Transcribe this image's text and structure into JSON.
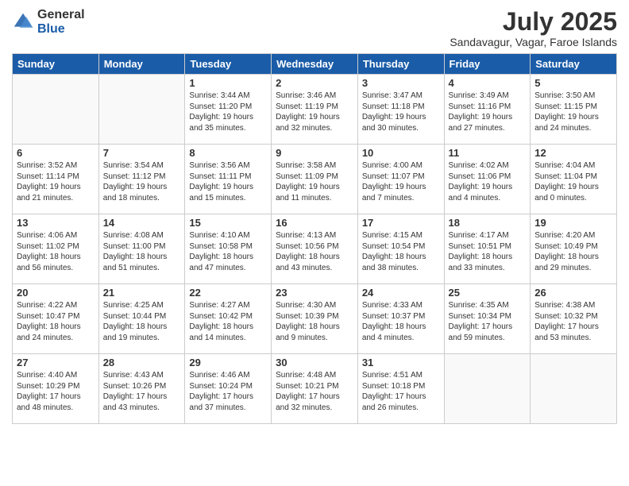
{
  "logo": {
    "general": "General",
    "blue": "Blue"
  },
  "header": {
    "month": "July 2025",
    "location": "Sandavagur, Vagar, Faroe Islands"
  },
  "weekdays": [
    "Sunday",
    "Monday",
    "Tuesday",
    "Wednesday",
    "Thursday",
    "Friday",
    "Saturday"
  ],
  "weeks": [
    [
      {
        "day": "",
        "info": ""
      },
      {
        "day": "",
        "info": ""
      },
      {
        "day": "1",
        "info": "Sunrise: 3:44 AM\nSunset: 11:20 PM\nDaylight: 19 hours and 35 minutes."
      },
      {
        "day": "2",
        "info": "Sunrise: 3:46 AM\nSunset: 11:19 PM\nDaylight: 19 hours and 32 minutes."
      },
      {
        "day": "3",
        "info": "Sunrise: 3:47 AM\nSunset: 11:18 PM\nDaylight: 19 hours and 30 minutes."
      },
      {
        "day": "4",
        "info": "Sunrise: 3:49 AM\nSunset: 11:16 PM\nDaylight: 19 hours and 27 minutes."
      },
      {
        "day": "5",
        "info": "Sunrise: 3:50 AM\nSunset: 11:15 PM\nDaylight: 19 hours and 24 minutes."
      }
    ],
    [
      {
        "day": "6",
        "info": "Sunrise: 3:52 AM\nSunset: 11:14 PM\nDaylight: 19 hours and 21 minutes."
      },
      {
        "day": "7",
        "info": "Sunrise: 3:54 AM\nSunset: 11:12 PM\nDaylight: 19 hours and 18 minutes."
      },
      {
        "day": "8",
        "info": "Sunrise: 3:56 AM\nSunset: 11:11 PM\nDaylight: 19 hours and 15 minutes."
      },
      {
        "day": "9",
        "info": "Sunrise: 3:58 AM\nSunset: 11:09 PM\nDaylight: 19 hours and 11 minutes."
      },
      {
        "day": "10",
        "info": "Sunrise: 4:00 AM\nSunset: 11:07 PM\nDaylight: 19 hours and 7 minutes."
      },
      {
        "day": "11",
        "info": "Sunrise: 4:02 AM\nSunset: 11:06 PM\nDaylight: 19 hours and 4 minutes."
      },
      {
        "day": "12",
        "info": "Sunrise: 4:04 AM\nSunset: 11:04 PM\nDaylight: 19 hours and 0 minutes."
      }
    ],
    [
      {
        "day": "13",
        "info": "Sunrise: 4:06 AM\nSunset: 11:02 PM\nDaylight: 18 hours and 56 minutes."
      },
      {
        "day": "14",
        "info": "Sunrise: 4:08 AM\nSunset: 11:00 PM\nDaylight: 18 hours and 51 minutes."
      },
      {
        "day": "15",
        "info": "Sunrise: 4:10 AM\nSunset: 10:58 PM\nDaylight: 18 hours and 47 minutes."
      },
      {
        "day": "16",
        "info": "Sunrise: 4:13 AM\nSunset: 10:56 PM\nDaylight: 18 hours and 43 minutes."
      },
      {
        "day": "17",
        "info": "Sunrise: 4:15 AM\nSunset: 10:54 PM\nDaylight: 18 hours and 38 minutes."
      },
      {
        "day": "18",
        "info": "Sunrise: 4:17 AM\nSunset: 10:51 PM\nDaylight: 18 hours and 33 minutes."
      },
      {
        "day": "19",
        "info": "Sunrise: 4:20 AM\nSunset: 10:49 PM\nDaylight: 18 hours and 29 minutes."
      }
    ],
    [
      {
        "day": "20",
        "info": "Sunrise: 4:22 AM\nSunset: 10:47 PM\nDaylight: 18 hours and 24 minutes."
      },
      {
        "day": "21",
        "info": "Sunrise: 4:25 AM\nSunset: 10:44 PM\nDaylight: 18 hours and 19 minutes."
      },
      {
        "day": "22",
        "info": "Sunrise: 4:27 AM\nSunset: 10:42 PM\nDaylight: 18 hours and 14 minutes."
      },
      {
        "day": "23",
        "info": "Sunrise: 4:30 AM\nSunset: 10:39 PM\nDaylight: 18 hours and 9 minutes."
      },
      {
        "day": "24",
        "info": "Sunrise: 4:33 AM\nSunset: 10:37 PM\nDaylight: 18 hours and 4 minutes."
      },
      {
        "day": "25",
        "info": "Sunrise: 4:35 AM\nSunset: 10:34 PM\nDaylight: 17 hours and 59 minutes."
      },
      {
        "day": "26",
        "info": "Sunrise: 4:38 AM\nSunset: 10:32 PM\nDaylight: 17 hours and 53 minutes."
      }
    ],
    [
      {
        "day": "27",
        "info": "Sunrise: 4:40 AM\nSunset: 10:29 PM\nDaylight: 17 hours and 48 minutes."
      },
      {
        "day": "28",
        "info": "Sunrise: 4:43 AM\nSunset: 10:26 PM\nDaylight: 17 hours and 43 minutes."
      },
      {
        "day": "29",
        "info": "Sunrise: 4:46 AM\nSunset: 10:24 PM\nDaylight: 17 hours and 37 minutes."
      },
      {
        "day": "30",
        "info": "Sunrise: 4:48 AM\nSunset: 10:21 PM\nDaylight: 17 hours and 32 minutes."
      },
      {
        "day": "31",
        "info": "Sunrise: 4:51 AM\nSunset: 10:18 PM\nDaylight: 17 hours and 26 minutes."
      },
      {
        "day": "",
        "info": ""
      },
      {
        "day": "",
        "info": ""
      }
    ]
  ]
}
